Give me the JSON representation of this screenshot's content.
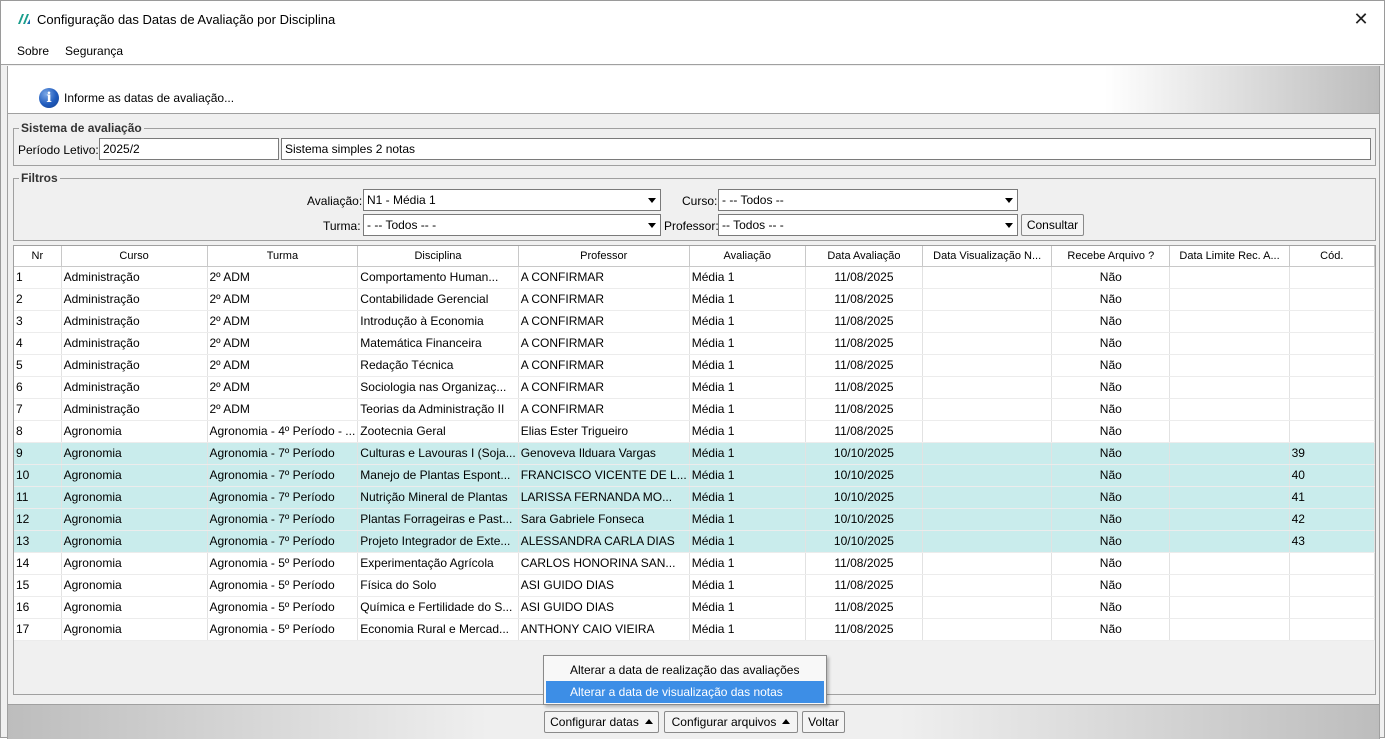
{
  "window": {
    "title": "Configuração das Datas de Avaliação por Disciplina"
  },
  "menu": [
    "Sobre",
    "Segurança"
  ],
  "info": {
    "message": "Informe as datas de avaliação..."
  },
  "sistema": {
    "legend": "Sistema de avaliação",
    "periodo_label": "Período Letivo:",
    "periodo_value": "2025/2",
    "sistema_value": "Sistema simples 2 notas"
  },
  "filtros": {
    "legend": "Filtros",
    "avaliacao_label": "Avaliação:",
    "avaliacao_value": "N1 - Média 1",
    "curso_label": "Curso:",
    "curso_value": "- -- Todos --",
    "turma_label": "Turma:",
    "turma_value": "- -- Todos -- -",
    "professor_label": "Professor:",
    "professor_value": "-- Todos -- -",
    "consultar_label": "Consultar"
  },
  "table": {
    "columns": [
      "Nr",
      "Curso",
      "Turma",
      "Disciplina",
      "Professor",
      "Avaliação",
      "Data Avaliação",
      "Data Visualização N...",
      "Recebe Arquivo ?",
      "Data Limite Rec. A...",
      "Cód."
    ],
    "rows": [
      {
        "nr": "1",
        "curso": "Administração",
        "turma": "2º ADM",
        "disciplina": "Comportamento Human...",
        "professor": "A CONFIRMAR",
        "avaliacao": "Média 1",
        "data": "11/08/2025",
        "vis": "",
        "recebe": "Não",
        "limite": "",
        "cod": "",
        "hl": false
      },
      {
        "nr": "2",
        "curso": "Administração",
        "turma": "2º ADM",
        "disciplina": "Contabilidade Gerencial",
        "professor": "A CONFIRMAR",
        "avaliacao": "Média 1",
        "data": "11/08/2025",
        "vis": "",
        "recebe": "Não",
        "limite": "",
        "cod": "",
        "hl": false
      },
      {
        "nr": "3",
        "curso": "Administração",
        "turma": "2º ADM",
        "disciplina": "Introdução à Economia",
        "professor": "A CONFIRMAR",
        "avaliacao": "Média 1",
        "data": "11/08/2025",
        "vis": "",
        "recebe": "Não",
        "limite": "",
        "cod": "",
        "hl": false
      },
      {
        "nr": "4",
        "curso": "Administração",
        "turma": "2º ADM",
        "disciplina": "Matemática Financeira",
        "professor": "A CONFIRMAR",
        "avaliacao": "Média 1",
        "data": "11/08/2025",
        "vis": "",
        "recebe": "Não",
        "limite": "",
        "cod": "",
        "hl": false
      },
      {
        "nr": "5",
        "curso": "Administração",
        "turma": "2º ADM",
        "disciplina": "Redação Técnica",
        "professor": "A CONFIRMAR",
        "avaliacao": "Média 1",
        "data": "11/08/2025",
        "vis": "",
        "recebe": "Não",
        "limite": "",
        "cod": "",
        "hl": false
      },
      {
        "nr": "6",
        "curso": "Administração",
        "turma": "2º ADM",
        "disciplina": "Sociologia nas Organizaç...",
        "professor": "A CONFIRMAR",
        "avaliacao": "Média 1",
        "data": "11/08/2025",
        "vis": "",
        "recebe": "Não",
        "limite": "",
        "cod": "",
        "hl": false
      },
      {
        "nr": "7",
        "curso": "Administração",
        "turma": "2º ADM",
        "disciplina": "Teorias da Administração II",
        "professor": "A CONFIRMAR",
        "avaliacao": "Média 1",
        "data": "11/08/2025",
        "vis": "",
        "recebe": "Não",
        "limite": "",
        "cod": "",
        "hl": false
      },
      {
        "nr": "8",
        "curso": "Agronomia",
        "turma": "Agronomia - 4º Período - ...",
        "disciplina": "Zootecnia Geral",
        "professor": "Elias Ester Trigueiro",
        "avaliacao": "Média 1",
        "data": "11/08/2025",
        "vis": "",
        "recebe": "Não",
        "limite": "",
        "cod": "",
        "hl": false
      },
      {
        "nr": "9",
        "curso": "Agronomia",
        "turma": "Agronomia - 7º Período",
        "disciplina": "Culturas e Lavouras I (Soja...",
        "professor": "Genoveva Ilduara Vargas",
        "avaliacao": "Média 1",
        "data": "10/10/2025",
        "vis": "",
        "recebe": "Não",
        "limite": "",
        "cod": "39",
        "hl": true
      },
      {
        "nr": "10",
        "curso": "Agronomia",
        "turma": "Agronomia - 7º Período",
        "disciplina": "Manejo de Plantas Espont...",
        "professor": "FRANCISCO VICENTE DE L...",
        "avaliacao": "Média 1",
        "data": "10/10/2025",
        "vis": "",
        "recebe": "Não",
        "limite": "",
        "cod": "40",
        "hl": true
      },
      {
        "nr": "11",
        "curso": "Agronomia",
        "turma": "Agronomia - 7º Período",
        "disciplina": "Nutrição Mineral de Plantas",
        "professor": "LARISSA FERNANDA MO...",
        "avaliacao": "Média 1",
        "data": "10/10/2025",
        "vis": "",
        "recebe": "Não",
        "limite": "",
        "cod": "41",
        "hl": true
      },
      {
        "nr": "12",
        "curso": "Agronomia",
        "turma": "Agronomia - 7º Período",
        "disciplina": "Plantas Forrageiras e Past...",
        "professor": "Sara Gabriele Fonseca",
        "avaliacao": "Média 1",
        "data": "10/10/2025",
        "vis": "",
        "recebe": "Não",
        "limite": "",
        "cod": "42",
        "hl": true
      },
      {
        "nr": "13",
        "curso": "Agronomia",
        "turma": "Agronomia - 7º Período",
        "disciplina": "Projeto Integrador de Exte...",
        "professor": "ALESSANDRA CARLA DIAS",
        "avaliacao": "Média 1",
        "data": "10/10/2025",
        "vis": "",
        "recebe": "Não",
        "limite": "",
        "cod": "43",
        "hl": true
      },
      {
        "nr": "14",
        "curso": "Agronomia",
        "turma": "Agronomia - 5º Período",
        "disciplina": "Experimentação Agrícola",
        "professor": "CARLOS HONORINA SAN...",
        "avaliacao": "Média 1",
        "data": "11/08/2025",
        "vis": "",
        "recebe": "Não",
        "limite": "",
        "cod": "",
        "hl": false
      },
      {
        "nr": "15",
        "curso": "Agronomia",
        "turma": "Agronomia - 5º Período",
        "disciplina": "Física do Solo",
        "professor": "ASI GUIDO DIAS",
        "avaliacao": "Média 1",
        "data": "11/08/2025",
        "vis": "",
        "recebe": "Não",
        "limite": "",
        "cod": "",
        "hl": false
      },
      {
        "nr": "16",
        "curso": "Agronomia",
        "turma": "Agronomia - 5º Período",
        "disciplina": "Química e Fertilidade do S...",
        "professor": "ASI GUIDO DIAS",
        "avaliacao": "Média 1",
        "data": "11/08/2025",
        "vis": "",
        "recebe": "Não",
        "limite": "",
        "cod": "",
        "hl": false
      },
      {
        "nr": "17",
        "curso": "Agronomia",
        "turma": "Agronomia - 5º Período",
        "disciplina": "Economia Rural e Mercad...",
        "professor": "ANTHONY CAIO VIEIRA",
        "avaliacao": "Média 1",
        "data": "11/08/2025",
        "vis": "",
        "recebe": "Não",
        "limite": "",
        "cod": "",
        "hl": false
      }
    ]
  },
  "popup": {
    "items": [
      "Alterar a data de realização das avaliações",
      "Alterar a data de visualização das notas"
    ]
  },
  "bottom": {
    "configurar_datas": "Configurar datas",
    "configurar_arquivos": "Configurar arquivos",
    "voltar": "Voltar"
  },
  "colors": {
    "highlight_row": "#c9ecec",
    "menu_selection": "#3d8ee6"
  }
}
